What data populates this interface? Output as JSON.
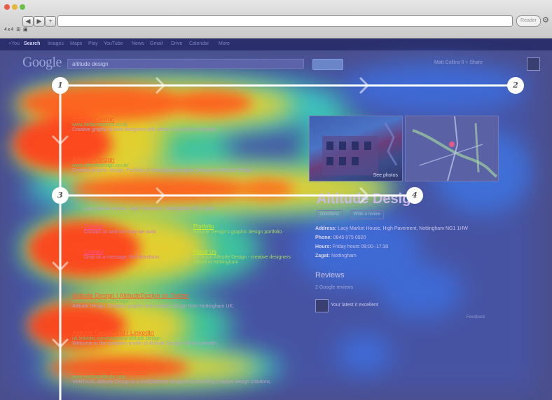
{
  "browser": {
    "reader_label": "Reader",
    "bookmarks_text": "4x4 ⊞ ▣",
    "nav_back": "◀",
    "nav_forward": "▶",
    "nav_add": "+",
    "gear": "⚙"
  },
  "google_bar": {
    "items": [
      "+You",
      "Search",
      "Images",
      "Maps",
      "Play",
      "YouTube",
      "News",
      "Gmail",
      "Drive",
      "Calendar",
      "More"
    ]
  },
  "search": {
    "logo": "Google",
    "query": "altitude design",
    "signin": "Matt Collins   0   + Share"
  },
  "results": [
    {
      "title": "Altitude Design",
      "url": "www.altitudedesign.co.uk/",
      "snippet": "Creative graphic design, Portfolio of Nottingham Graphic Designers Altitude Design."
    },
    {
      "title": "Altitude Design | AltitudeDesign on Twitter",
      "url": "twitter.com/AltitudeDesign",
      "snippet": "Altitude Design. Creative graphic and website design from Nottingham UK."
    },
    {
      "title": "Altitude Design Ltd | LinkedIn",
      "url": "uk.linkedin.com/company/altitude-design",
      "snippet": "Welcome to the company profile of Altitude Design Ltd on LinkedIn."
    },
    {
      "title": "Vertical Altitude Design Inc",
      "url": "www.verticalaltitude.com",
      "snippet": "VERTICAL Altitude Design is a multiplatform design firm providing creative design solutions."
    }
  ],
  "ad": {
    "title": "Altitude Design",
    "url": "www.deltacreations.co.uk",
    "snippet": "Creative graphic & web designers with offices in Lincoln & Newark"
  },
  "address_line": "Lacy Market House, High Pavement, Nottingham NG1 1HW",
  "sitelinks": [
    {
      "title": "Contact",
      "snippet": "Contact us and see how we work"
    },
    {
      "title": "Portfolio",
      "snippet": "Altitude Design's graphic design portfolio"
    },
    {
      "title": "Contact",
      "snippet": "Drop us a message, find directions"
    },
    {
      "title": "About Us",
      "snippet": "All about Altitude Design - creative designers based in Nottingham"
    }
  ],
  "knowledge_panel": {
    "name": "Altitude Design",
    "buttons": [
      "Directions",
      "Write a review"
    ],
    "address": "Lacy Market House, High Pavement, Nottingham NG1 1HW",
    "phone": "0845 075 0920",
    "hours": "Friday hours 09:00–17:30",
    "zagat": "Nottingham",
    "reviews_heading": "Reviews",
    "reviews_count": "2 Google reviews",
    "review_snippet": "Your latest it excellent",
    "see_photos": "See photos",
    "feedback": "Feedback"
  },
  "path_markers": [
    "1",
    "2",
    "3",
    "4"
  ],
  "colors": {
    "path_line": "#ffffff",
    "heat_hot": "#ff3a1a",
    "heat_warm": "#ffd21e",
    "heat_mid": "#3ad8c8",
    "heat_cool": "#3f5fd8",
    "page_bg": "#4b4f8e"
  }
}
